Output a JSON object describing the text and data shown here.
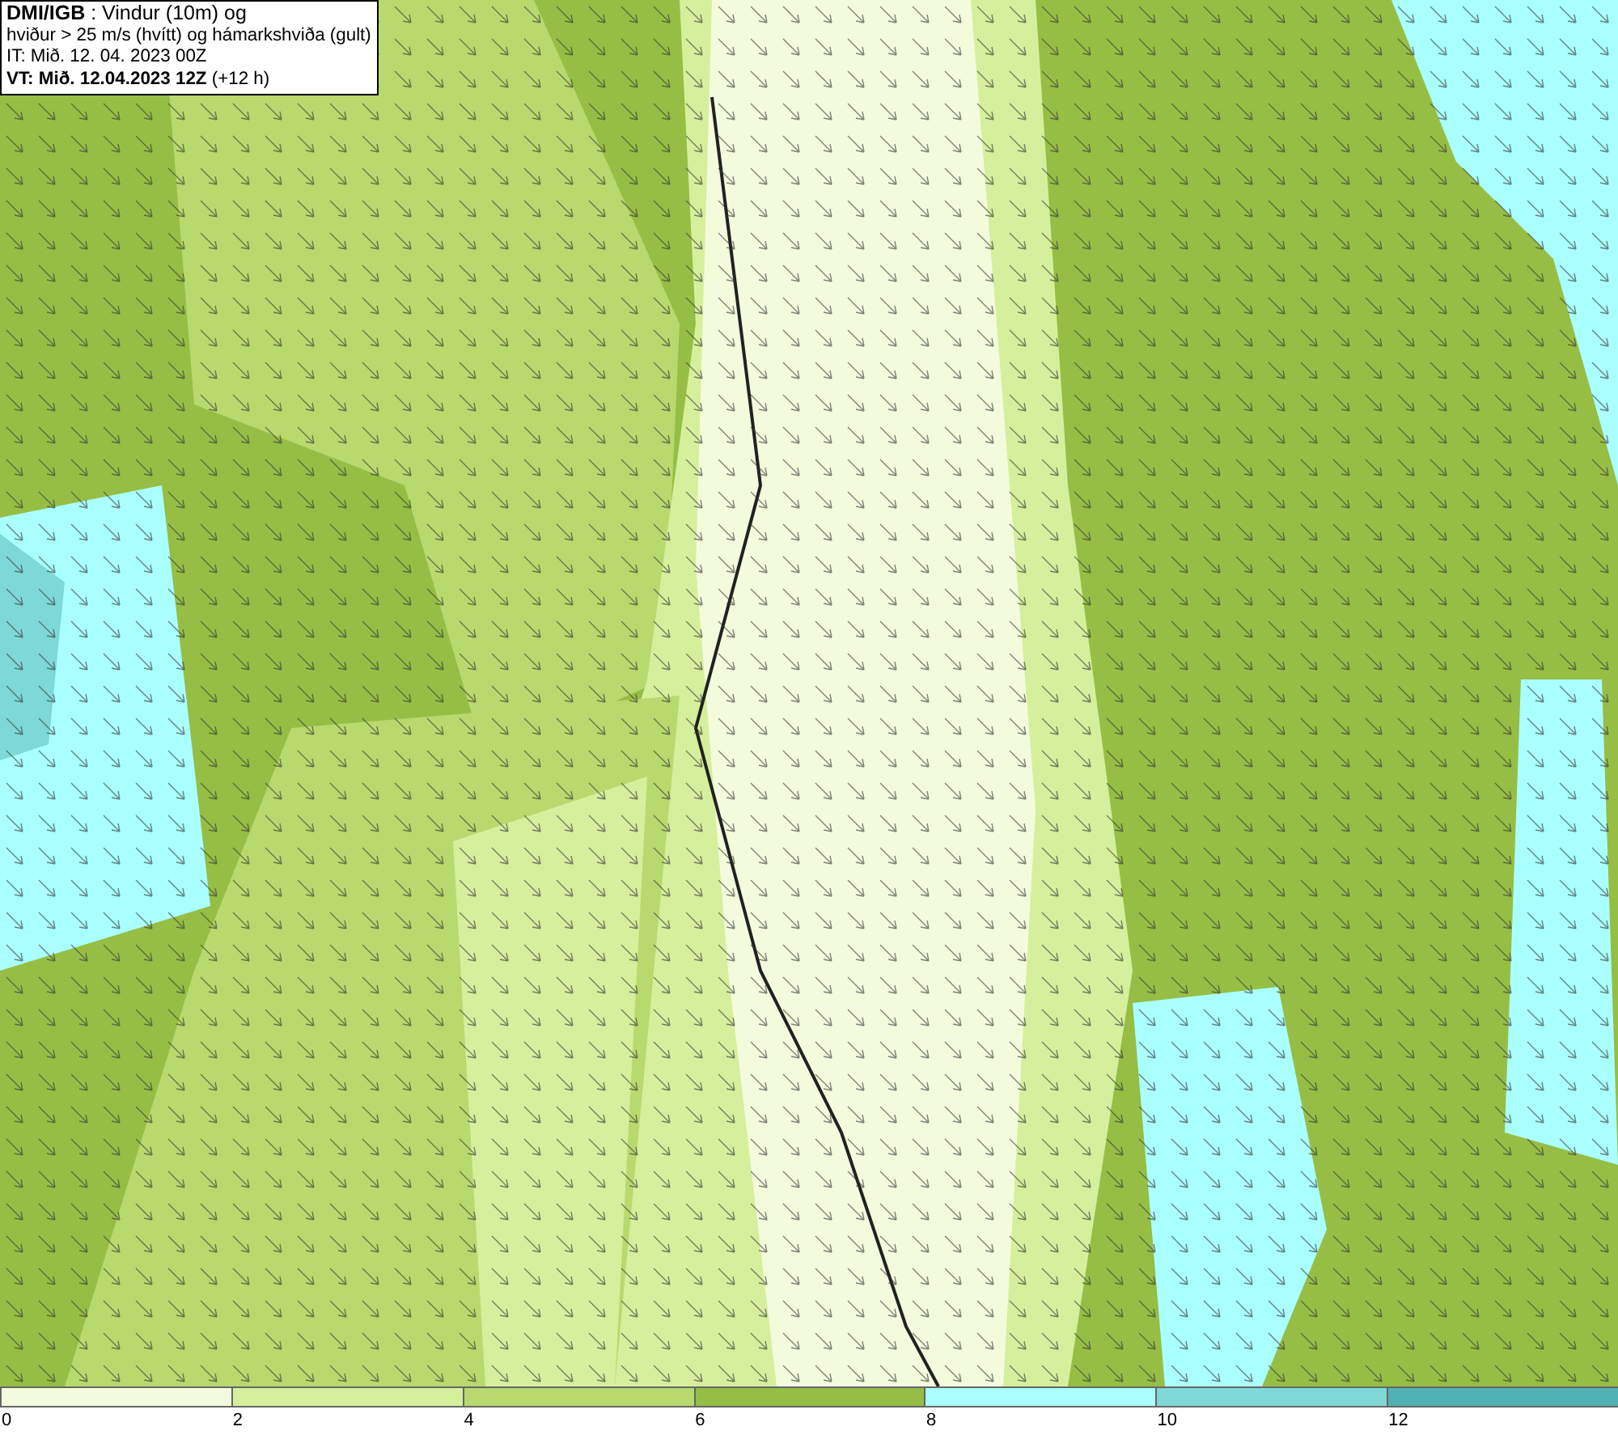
{
  "title_box": {
    "lines": [
      "**DMI/IGB** : Vindur (10m) og",
      "hviður > 25 m/s (hvítt) og hámarkshviða (gult)",
      "IT: Mið. 12. 04. 2023 00Z",
      "**VT: Mið. 12.04.2023 12Z** (+12 h)"
    ]
  },
  "legend": {
    "segments": [
      {
        "label": "0",
        "color": "#f4fbdc"
      },
      {
        "label": "2",
        "color": "#d6ef9c"
      },
      {
        "label": "4",
        "color": "#b8d96e"
      },
      {
        "label": "6",
        "color": "#96be45"
      },
      {
        "label": "8",
        "color": "#aaffff"
      },
      {
        "label": "10",
        "color": "#7fd8d8"
      },
      {
        "label": "12",
        "color": "#52b1b4"
      }
    ]
  }
}
